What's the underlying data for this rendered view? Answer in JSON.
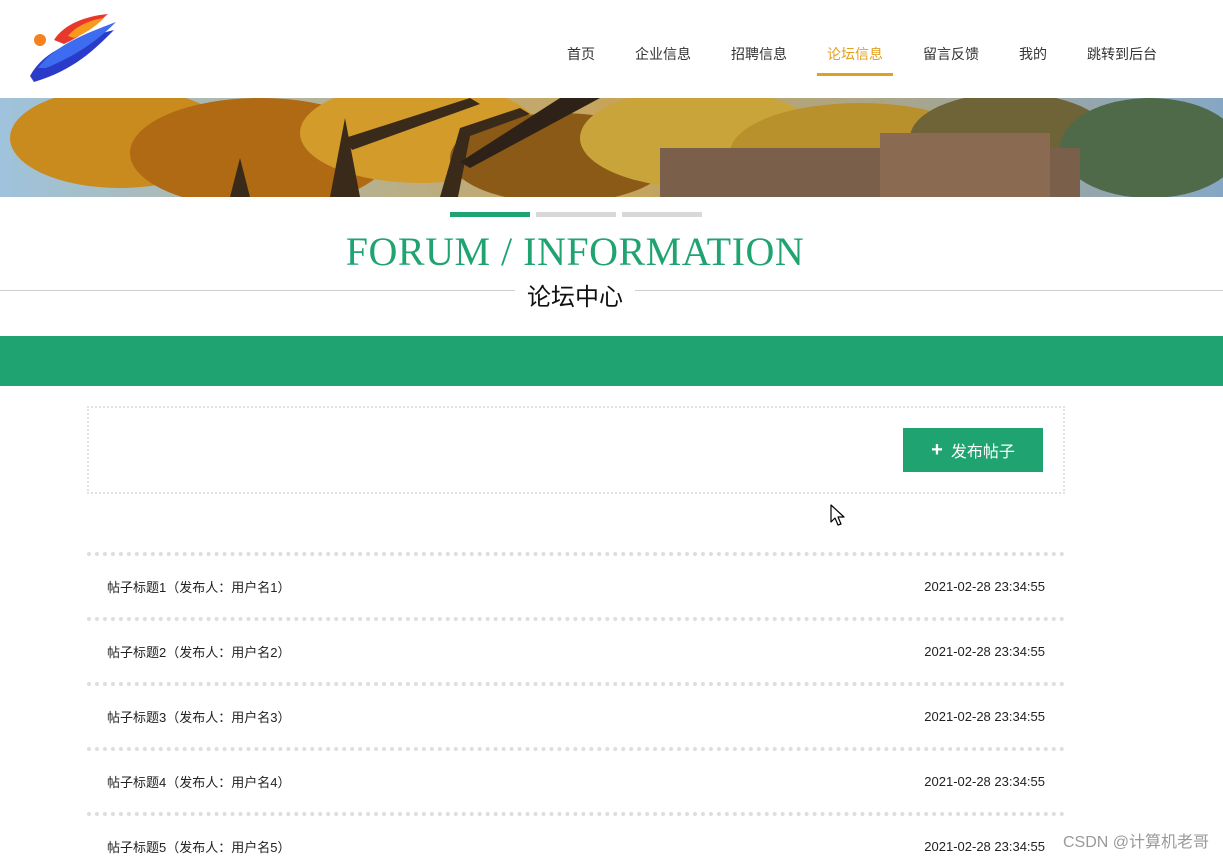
{
  "header": {
    "nav": [
      {
        "label": "首页",
        "active": false
      },
      {
        "label": "企业信息",
        "active": false
      },
      {
        "label": "招聘信息",
        "active": false
      },
      {
        "label": "论坛信息",
        "active": true
      },
      {
        "label": "留言反馈",
        "active": false
      },
      {
        "label": "我的",
        "active": false
      },
      {
        "label": "跳转到后台",
        "active": false
      }
    ]
  },
  "section": {
    "title_en": "FORUM / INFORMATION",
    "title_cn": "论坛中心"
  },
  "actions": {
    "publish_icon": "plus-icon",
    "publish_label": "发布帖子"
  },
  "posts": [
    {
      "title": "帖子标题1（发布人：用户名1）",
      "time": "2021-02-28 23:34:55"
    },
    {
      "title": "帖子标题2（发布人：用户名2）",
      "time": "2021-02-28 23:34:55"
    },
    {
      "title": "帖子标题3（发布人：用户名3）",
      "time": "2021-02-28 23:34:55"
    },
    {
      "title": "帖子标题4（发布人：用户名4）",
      "time": "2021-02-28 23:34:55"
    },
    {
      "title": "帖子标题5（发布人：用户名5）",
      "time": "2021-02-28 23:34:55"
    }
  ],
  "watermark": "CSDN @计算机老哥",
  "colors": {
    "accent": "#1fa370",
    "nav_active": "#e2a020"
  }
}
